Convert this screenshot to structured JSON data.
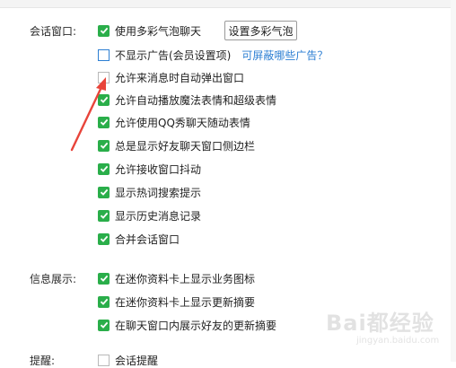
{
  "sections": {
    "chat_window": "会话窗口:",
    "info_display": "信息展示:",
    "reminder": "提醒:"
  },
  "chat_options": [
    {
      "label": "使用多彩气泡聊天",
      "checked": true
    },
    {
      "label": "不显示广告(会员设置项)",
      "checked": false,
      "link": "可屏蔽哪些广告？"
    },
    {
      "label": "允许来消息时自动弹出窗口",
      "checked": false
    },
    {
      "label": "允许自动播放魔法表情和超级表情",
      "checked": true
    },
    {
      "label": "允许使用QQ秀聊天随动表情",
      "checked": true
    },
    {
      "label": "总是显示好友聊天窗口侧边栏",
      "checked": true
    },
    {
      "label": "允许接收窗口抖动",
      "checked": true
    },
    {
      "label": "显示热词搜索提示",
      "checked": true
    },
    {
      "label": "显示历史消息记录",
      "checked": true
    },
    {
      "label": "合并会话窗口",
      "checked": true
    }
  ],
  "bubble_button": "设置多彩气泡",
  "info_options": [
    {
      "label": "在迷你资料卡上显示业务图标",
      "checked": true
    },
    {
      "label": "在迷你资料卡上显示更新摘要",
      "checked": true
    },
    {
      "label": "在聊天窗口内展示好友的更新摘要",
      "checked": true
    }
  ],
  "reminder_options": [
    {
      "label": "会话提醒",
      "checked": false
    }
  ],
  "watermark": {
    "text": "Bai都经验",
    "sub": "jingyan.baidu.com"
  },
  "colors": {
    "check_green": "#2aae4a",
    "link_blue": "#2d7fd3",
    "arrow_red": "#e8443a"
  }
}
